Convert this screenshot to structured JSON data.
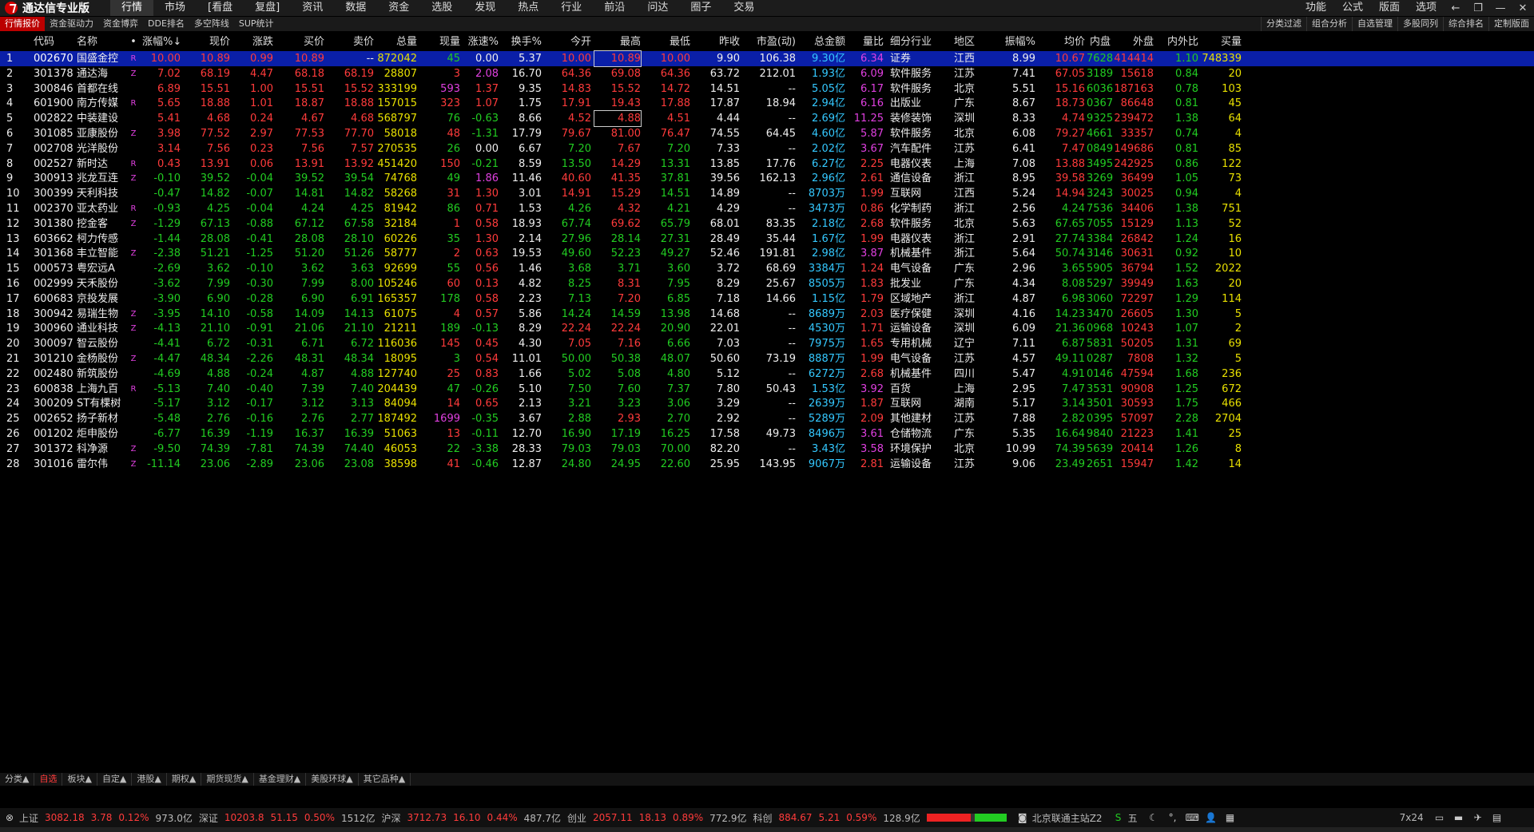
{
  "app": {
    "title": "通达信专业版"
  },
  "menu": [
    "行情",
    "市场",
    "[看盘",
    "复盘]",
    "资讯",
    "数据",
    "资金",
    "选股",
    "发现",
    "热点",
    "行业",
    "前沿",
    "问达",
    "圈子",
    "交易"
  ],
  "menu_right": [
    "功能",
    "公式",
    "版面",
    "选项"
  ],
  "subtoolbar": {
    "left": [
      "行情报价",
      "资金驱动力",
      "资金博弈",
      "DDE排名",
      "多空阵线",
      "SUP统计"
    ],
    "right": [
      "分类过滤",
      "组合分析",
      "自选管理",
      "多股同列",
      "综合排名",
      "定制版面"
    ]
  },
  "columns": [
    "",
    "代码",
    "名称",
    "•",
    "涨幅%↓",
    "现价",
    "涨跌",
    "买价",
    "卖价",
    "总量",
    "现量",
    "涨速%",
    "换手%",
    "今开",
    "最高",
    "最低",
    "昨收",
    "市盈(动)",
    "总金额",
    "量比",
    "细分行业",
    "地区",
    "振幅%",
    "均价",
    "内盘",
    "外盘",
    "内外比",
    "买量"
  ],
  "rows": [
    {
      "n": "1",
      "code": "002670",
      "name": "国盛金控",
      "t": "R",
      "chg": "10.00",
      "price": "10.89",
      "diff": "0.99",
      "bid": "10.89",
      "ask": "--",
      "vol": "872042",
      "cur": "45",
      "spd": "0.00",
      "turn": "5.37",
      "open": "10.00",
      "high": "10.89",
      "low": "10.00",
      "pre": "9.90",
      "pe": "106.38",
      "amt": "9.30亿",
      "lb": "6.34",
      "ind": "证券",
      "reg": "江西",
      "amp": "8.99",
      "avg": "10.67",
      "inn": "7628",
      "out": "414414",
      "ratio": "1.10",
      "bvol": "748339"
    },
    {
      "n": "2",
      "code": "301378",
      "name": "通达海",
      "t": "Z",
      "chg": "7.02",
      "price": "68.19",
      "diff": "4.47",
      "bid": "68.18",
      "ask": "68.19",
      "vol": "28807",
      "cur": "3",
      "spd": "2.08",
      "turn": "16.70",
      "open": "64.36",
      "high": "69.08",
      "low": "64.36",
      "pre": "63.72",
      "pe": "212.01",
      "amt": "1.93亿",
      "lb": "6.09",
      "ind": "软件服务",
      "reg": "江苏",
      "amp": "7.41",
      "avg": "67.05",
      "inn": "3189",
      "out": "15618",
      "ratio": "0.84",
      "bvol": "20"
    },
    {
      "n": "3",
      "code": "300846",
      "name": "首都在线",
      "t": "",
      "chg": "6.89",
      "price": "15.51",
      "diff": "1.00",
      "bid": "15.51",
      "ask": "15.52",
      "vol": "333199",
      "cur": "593",
      "spd": "1.37",
      "turn": "9.35",
      "open": "14.83",
      "high": "15.52",
      "low": "14.72",
      "pre": "14.51",
      "pe": "--",
      "amt": "5.05亿",
      "lb": "6.17",
      "ind": "软件服务",
      "reg": "北京",
      "amp": "5.51",
      "avg": "15.16",
      "inn": "6036",
      "out": "187163",
      "ratio": "0.78",
      "bvol": "103"
    },
    {
      "n": "4",
      "code": "601900",
      "name": "南方传媒",
      "t": "R",
      "chg": "5.65",
      "price": "18.88",
      "diff": "1.01",
      "bid": "18.87",
      "ask": "18.88",
      "vol": "157015",
      "cur": "323",
      "spd": "1.07",
      "turn": "1.75",
      "open": "17.91",
      "high": "19.43",
      "low": "17.88",
      "pre": "17.87",
      "pe": "18.94",
      "amt": "2.94亿",
      "lb": "6.16",
      "ind": "出版业",
      "reg": "广东",
      "amp": "8.67",
      "avg": "18.73",
      "inn": "0367",
      "out": "86648",
      "ratio": "0.81",
      "bvol": "45"
    },
    {
      "n": "5",
      "code": "002822",
      "name": "中装建设",
      "t": "",
      "chg": "5.41",
      "price": "4.68",
      "diff": "0.24",
      "bid": "4.67",
      "ask": "4.68",
      "vol": "568797",
      "cur": "76",
      "spd": "-0.63",
      "turn": "8.66",
      "open": "4.52",
      "high": "4.88",
      "low": "4.51",
      "pre": "4.44",
      "pe": "--",
      "amt": "2.69亿",
      "lb": "11.25",
      "ind": "装修装饰",
      "reg": "深圳",
      "amp": "8.33",
      "avg": "4.74",
      "inn": "9325",
      "out": "239472",
      "ratio": "1.38",
      "bvol": "64"
    },
    {
      "n": "6",
      "code": "301085",
      "name": "亚康股份",
      "t": "Z",
      "chg": "3.98",
      "price": "77.52",
      "diff": "2.97",
      "bid": "77.53",
      "ask": "77.70",
      "vol": "58018",
      "cur": "48",
      "spd": "-1.31",
      "turn": "17.79",
      "open": "79.67",
      "high": "81.00",
      "low": "76.47",
      "pre": "74.55",
      "pe": "64.45",
      "amt": "4.60亿",
      "lb": "5.87",
      "ind": "软件服务",
      "reg": "北京",
      "amp": "6.08",
      "avg": "79.27",
      "inn": "4661",
      "out": "33357",
      "ratio": "0.74",
      "bvol": "4"
    },
    {
      "n": "7",
      "code": "002708",
      "name": "光洋股份",
      "t": "",
      "chg": "3.14",
      "price": "7.56",
      "diff": "0.23",
      "bid": "7.56",
      "ask": "7.57",
      "vol": "270535",
      "cur": "26",
      "spd": "0.00",
      "turn": "6.67",
      "open": "7.20",
      "high": "7.67",
      "low": "7.20",
      "pre": "7.33",
      "pe": "--",
      "amt": "2.02亿",
      "lb": "3.67",
      "ind": "汽车配件",
      "reg": "江苏",
      "amp": "6.41",
      "avg": "7.47",
      "inn": "0849",
      "out": "149686",
      "ratio": "0.81",
      "bvol": "85"
    },
    {
      "n": "8",
      "code": "002527",
      "name": "新时达",
      "t": "R",
      "chg": "0.43",
      "price": "13.91",
      "diff": "0.06",
      "bid": "13.91",
      "ask": "13.92",
      "vol": "451420",
      "cur": "150",
      "spd": "-0.21",
      "turn": "8.59",
      "open": "13.50",
      "high": "14.29",
      "low": "13.31",
      "pre": "13.85",
      "pe": "17.76",
      "amt": "6.27亿",
      "lb": "2.25",
      "ind": "电器仪表",
      "reg": "上海",
      "amp": "7.08",
      "avg": "13.88",
      "inn": "3495",
      "out": "242925",
      "ratio": "0.86",
      "bvol": "122"
    },
    {
      "n": "9",
      "code": "300913",
      "name": "兆龙互连",
      "t": "Z",
      "chg": "-0.10",
      "price": "39.52",
      "diff": "-0.04",
      "bid": "39.52",
      "ask": "39.54",
      "vol": "74768",
      "cur": "49",
      "spd": "1.86",
      "turn": "11.46",
      "open": "40.60",
      "high": "41.35",
      "low": "37.81",
      "pre": "39.56",
      "pe": "162.13",
      "amt": "2.96亿",
      "lb": "2.61",
      "ind": "通信设备",
      "reg": "浙江",
      "amp": "8.95",
      "avg": "39.58",
      "inn": "3269",
      "out": "36499",
      "ratio": "1.05",
      "bvol": "73"
    },
    {
      "n": "10",
      "code": "300399",
      "name": "天利科技",
      "t": "",
      "chg": "-0.47",
      "price": "14.82",
      "diff": "-0.07",
      "bid": "14.81",
      "ask": "14.82",
      "vol": "58268",
      "cur": "31",
      "spd": "1.30",
      "turn": "3.01",
      "open": "14.91",
      "high": "15.29",
      "low": "14.51",
      "pre": "14.89",
      "pe": "--",
      "amt": "8703万",
      "lb": "1.99",
      "ind": "互联网",
      "reg": "江西",
      "amp": "5.24",
      "avg": "14.94",
      "inn": "3243",
      "out": "30025",
      "ratio": "0.94",
      "bvol": "4"
    },
    {
      "n": "11",
      "code": "002370",
      "name": "亚太药业",
      "t": "R",
      "chg": "-0.93",
      "price": "4.25",
      "diff": "-0.04",
      "bid": "4.24",
      "ask": "4.25",
      "vol": "81942",
      "cur": "86",
      "spd": "0.71",
      "turn": "1.53",
      "open": "4.26",
      "high": "4.32",
      "low": "4.21",
      "pre": "4.29",
      "pe": "--",
      "amt": "3473万",
      "lb": "0.86",
      "ind": "化学制药",
      "reg": "浙江",
      "amp": "2.56",
      "avg": "4.24",
      "inn": "7536",
      "out": "34406",
      "ratio": "1.38",
      "bvol": "751"
    },
    {
      "n": "12",
      "code": "301380",
      "name": "挖金客",
      "t": "Z",
      "chg": "-1.29",
      "price": "67.13",
      "diff": "-0.88",
      "bid": "67.12",
      "ask": "67.58",
      "vol": "32184",
      "cur": "1",
      "spd": "0.58",
      "turn": "18.93",
      "open": "67.74",
      "high": "69.62",
      "low": "65.79",
      "pre": "68.01",
      "pe": "83.35",
      "amt": "2.18亿",
      "lb": "2.68",
      "ind": "软件服务",
      "reg": "北京",
      "amp": "5.63",
      "avg": "67.65",
      "inn": "7055",
      "out": "15129",
      "ratio": "1.13",
      "bvol": "52"
    },
    {
      "n": "13",
      "code": "603662",
      "name": "柯力传感",
      "t": "",
      "chg": "-1.44",
      "price": "28.08",
      "diff": "-0.41",
      "bid": "28.08",
      "ask": "28.10",
      "vol": "60226",
      "cur": "35",
      "spd": "1.30",
      "turn": "2.14",
      "open": "27.96",
      "high": "28.14",
      "low": "27.31",
      "pre": "28.49",
      "pe": "35.44",
      "amt": "1.67亿",
      "lb": "1.99",
      "ind": "电器仪表",
      "reg": "浙江",
      "amp": "2.91",
      "avg": "27.74",
      "inn": "3384",
      "out": "26842",
      "ratio": "1.24",
      "bvol": "16"
    },
    {
      "n": "14",
      "code": "301368",
      "name": "丰立智能",
      "t": "Z",
      "chg": "-2.38",
      "price": "51.21",
      "diff": "-1.25",
      "bid": "51.20",
      "ask": "51.26",
      "vol": "58777",
      "cur": "2",
      "spd": "0.63",
      "turn": "19.53",
      "open": "49.60",
      "high": "52.23",
      "low": "49.27",
      "pre": "52.46",
      "pe": "191.81",
      "amt": "2.98亿",
      "lb": "3.87",
      "ind": "机械基件",
      "reg": "浙江",
      "amp": "5.64",
      "avg": "50.74",
      "inn": "3146",
      "out": "30631",
      "ratio": "0.92",
      "bvol": "10"
    },
    {
      "n": "15",
      "code": "000573",
      "name": "粤宏远A",
      "t": "",
      "chg": "-2.69",
      "price": "3.62",
      "diff": "-0.10",
      "bid": "3.62",
      "ask": "3.63",
      "vol": "92699",
      "cur": "55",
      "spd": "0.56",
      "turn": "1.46",
      "open": "3.68",
      "high": "3.71",
      "low": "3.60",
      "pre": "3.72",
      "pe": "68.69",
      "amt": "3384万",
      "lb": "1.24",
      "ind": "电气设备",
      "reg": "广东",
      "amp": "2.96",
      "avg": "3.65",
      "inn": "5905",
      "out": "36794",
      "ratio": "1.52",
      "bvol": "2022"
    },
    {
      "n": "16",
      "code": "002999",
      "name": "天禾股份",
      "t": "",
      "chg": "-3.62",
      "price": "7.99",
      "diff": "-0.30",
      "bid": "7.99",
      "ask": "8.00",
      "vol": "105246",
      "cur": "60",
      "spd": "0.13",
      "turn": "4.82",
      "open": "8.25",
      "high": "8.31",
      "low": "7.95",
      "pre": "8.29",
      "pe": "25.67",
      "amt": "8505万",
      "lb": "1.83",
      "ind": "批发业",
      "reg": "广东",
      "amp": "4.34",
      "avg": "8.08",
      "inn": "5297",
      "out": "39949",
      "ratio": "1.63",
      "bvol": "20"
    },
    {
      "n": "17",
      "code": "600683",
      "name": "京投发展",
      "t": "",
      "chg": "-3.90",
      "price": "6.90",
      "diff": "-0.28",
      "bid": "6.90",
      "ask": "6.91",
      "vol": "165357",
      "cur": "178",
      "spd": "0.58",
      "turn": "2.23",
      "open": "7.13",
      "high": "7.20",
      "low": "6.85",
      "pre": "7.18",
      "pe": "14.66",
      "amt": "1.15亿",
      "lb": "1.79",
      "ind": "区域地产",
      "reg": "浙江",
      "amp": "4.87",
      "avg": "6.98",
      "inn": "3060",
      "out": "72297",
      "ratio": "1.29",
      "bvol": "114"
    },
    {
      "n": "18",
      "code": "300942",
      "name": "易瑞生物",
      "t": "Z",
      "chg": "-3.95",
      "price": "14.10",
      "diff": "-0.58",
      "bid": "14.09",
      "ask": "14.13",
      "vol": "61075",
      "cur": "4",
      "spd": "0.57",
      "turn": "5.86",
      "open": "14.24",
      "high": "14.59",
      "low": "13.98",
      "pre": "14.68",
      "pe": "--",
      "amt": "8689万",
      "lb": "2.03",
      "ind": "医疗保健",
      "reg": "深圳",
      "amp": "4.16",
      "avg": "14.23",
      "inn": "3470",
      "out": "26605",
      "ratio": "1.30",
      "bvol": "5"
    },
    {
      "n": "19",
      "code": "300960",
      "name": "通业科技",
      "t": "Z",
      "chg": "-4.13",
      "price": "21.10",
      "diff": "-0.91",
      "bid": "21.06",
      "ask": "21.10",
      "vol": "21211",
      "cur": "189",
      "spd": "-0.13",
      "turn": "8.29",
      "open": "22.24",
      "high": "22.24",
      "low": "20.90",
      "pre": "22.01",
      "pe": "--",
      "amt": "4530万",
      "lb": "1.71",
      "ind": "运输设备",
      "reg": "深圳",
      "amp": "6.09",
      "avg": "21.36",
      "inn": "0968",
      "out": "10243",
      "ratio": "1.07",
      "bvol": "2"
    },
    {
      "n": "20",
      "code": "300097",
      "name": "智云股份",
      "t": "",
      "chg": "-4.41",
      "price": "6.72",
      "diff": "-0.31",
      "bid": "6.71",
      "ask": "6.72",
      "vol": "116036",
      "cur": "145",
      "spd": "0.45",
      "turn": "4.30",
      "open": "7.05",
      "high": "7.16",
      "low": "6.66",
      "pre": "7.03",
      "pe": "--",
      "amt": "7975万",
      "lb": "1.65",
      "ind": "专用机械",
      "reg": "辽宁",
      "amp": "7.11",
      "avg": "6.87",
      "inn": "5831",
      "out": "50205",
      "ratio": "1.31",
      "bvol": "69"
    },
    {
      "n": "21",
      "code": "301210",
      "name": "金杨股份",
      "t": "Z",
      "chg": "-4.47",
      "price": "48.34",
      "diff": "-2.26",
      "bid": "48.31",
      "ask": "48.34",
      "vol": "18095",
      "cur": "3",
      "spd": "0.54",
      "turn": "11.01",
      "open": "50.00",
      "high": "50.38",
      "low": "48.07",
      "pre": "50.60",
      "pe": "73.19",
      "amt": "8887万",
      "lb": "1.99",
      "ind": "电气设备",
      "reg": "江苏",
      "amp": "4.57",
      "avg": "49.11",
      "inn": "0287",
      "out": "7808",
      "ratio": "1.32",
      "bvol": "5"
    },
    {
      "n": "22",
      "code": "002480",
      "name": "新筑股份",
      "t": "",
      "chg": "-4.69",
      "price": "4.88",
      "diff": "-0.24",
      "bid": "4.87",
      "ask": "4.88",
      "vol": "127740",
      "cur": "25",
      "spd": "0.83",
      "turn": "1.66",
      "open": "5.02",
      "high": "5.08",
      "low": "4.80",
      "pre": "5.12",
      "pe": "--",
      "amt": "6272万",
      "lb": "2.68",
      "ind": "机械基件",
      "reg": "四川",
      "amp": "5.47",
      "avg": "4.91",
      "inn": "0146",
      "out": "47594",
      "ratio": "1.68",
      "bvol": "236"
    },
    {
      "n": "23",
      "code": "600838",
      "name": "上海九百",
      "t": "R",
      "chg": "-5.13",
      "price": "7.40",
      "diff": "-0.40",
      "bid": "7.39",
      "ask": "7.40",
      "vol": "204439",
      "cur": "47",
      "spd": "-0.26",
      "turn": "5.10",
      "open": "7.50",
      "high": "7.60",
      "low": "7.37",
      "pre": "7.80",
      "pe": "50.43",
      "amt": "1.53亿",
      "lb": "3.92",
      "ind": "百货",
      "reg": "上海",
      "amp": "2.95",
      "avg": "7.47",
      "inn": "3531",
      "out": "90908",
      "ratio": "1.25",
      "bvol": "672"
    },
    {
      "n": "24",
      "code": "300209",
      "name": "ST有棵树",
      "t": "",
      "chg": "-5.17",
      "price": "3.12",
      "diff": "-0.17",
      "bid": "3.12",
      "ask": "3.13",
      "vol": "84094",
      "cur": "14",
      "spd": "0.65",
      "turn": "2.13",
      "open": "3.21",
      "high": "3.23",
      "low": "3.06",
      "pre": "3.29",
      "pe": "--",
      "amt": "2639万",
      "lb": "1.87",
      "ind": "互联网",
      "reg": "湖南",
      "amp": "5.17",
      "avg": "3.14",
      "inn": "3501",
      "out": "30593",
      "ratio": "1.75",
      "bvol": "466"
    },
    {
      "n": "25",
      "code": "002652",
      "name": "扬子新材",
      "t": "",
      "chg": "-5.48",
      "price": "2.76",
      "diff": "-0.16",
      "bid": "2.76",
      "ask": "2.77",
      "vol": "187492",
      "cur": "1699",
      "spd": "-0.35",
      "turn": "3.67",
      "open": "2.88",
      "high": "2.93",
      "low": "2.70",
      "pre": "2.92",
      "pe": "--",
      "amt": "5289万",
      "lb": "2.09",
      "ind": "其他建材",
      "reg": "江苏",
      "amp": "7.88",
      "avg": "2.82",
      "inn": "0395",
      "out": "57097",
      "ratio": "2.28",
      "bvol": "2704"
    },
    {
      "n": "26",
      "code": "001202",
      "name": "炬申股份",
      "t": "",
      "chg": "-6.77",
      "price": "16.39",
      "diff": "-1.19",
      "bid": "16.37",
      "ask": "16.39",
      "vol": "51063",
      "cur": "13",
      "spd": "-0.11",
      "turn": "12.70",
      "open": "16.90",
      "high": "17.19",
      "low": "16.25",
      "pre": "17.58",
      "pe": "49.73",
      "amt": "8496万",
      "lb": "3.61",
      "ind": "仓储物流",
      "reg": "广东",
      "amp": "5.35",
      "avg": "16.64",
      "inn": "9840",
      "out": "21223",
      "ratio": "1.41",
      "bvol": "25"
    },
    {
      "n": "27",
      "code": "301372",
      "name": "科净源",
      "t": "Z",
      "chg": "-9.50",
      "price": "74.39",
      "diff": "-7.81",
      "bid": "74.39",
      "ask": "74.40",
      "vol": "46053",
      "cur": "22",
      "spd": "-3.38",
      "turn": "28.33",
      "open": "79.03",
      "high": "79.03",
      "low": "70.00",
      "pre": "82.20",
      "pe": "--",
      "amt": "3.43亿",
      "lb": "3.58",
      "ind": "环境保护",
      "reg": "北京",
      "amp": "10.99",
      "avg": "74.39",
      "inn": "5639",
      "out": "20414",
      "ratio": "1.26",
      "bvol": "8"
    },
    {
      "n": "28",
      "code": "301016",
      "name": "雷尔伟",
      "t": "Z",
      "chg": "-11.14",
      "price": "23.06",
      "diff": "-2.89",
      "bid": "23.06",
      "ask": "23.08",
      "vol": "38598",
      "cur": "41",
      "spd": "-0.46",
      "turn": "12.87",
      "open": "24.80",
      "high": "24.95",
      "low": "22.60",
      "pre": "25.95",
      "pe": "143.95",
      "amt": "9067万",
      "lb": "2.81",
      "ind": "运输设备",
      "reg": "江苏",
      "amp": "9.06",
      "avg": "23.49",
      "inn": "2651",
      "out": "15947",
      "ratio": "1.42",
      "bvol": "14"
    }
  ],
  "bottom_tabs": [
    "分类▲",
    "自选",
    "板块▲",
    "自定▲",
    "港股▲",
    "期权▲",
    "期货现货▲",
    "基金理财▲",
    "美股环球▲",
    "其它品种▲"
  ],
  "status": {
    "sh_label": "上证",
    "sh_idx": "3082.18",
    "sh_chg": "3.78",
    "sh_pct": "0.12%",
    "sh_amt": "973.0亿",
    "sz_label": "深证",
    "sz_idx": "10203.8",
    "sz_chg": "51.15",
    "sz_pct": "0.50%",
    "sz_amt": "1512亿",
    "hs_label": "沪深",
    "hs_idx": "3712.73",
    "hs_chg": "16.10",
    "hs_pct": "0.44%",
    "hs_amt": "487.7亿",
    "cy_label": "创业",
    "cy_idx": "2057.11",
    "cy_chg": "18.13",
    "cy_pct": "0.89%",
    "cy_amt": "772.9亿",
    "kc_label": "科创",
    "kc_idx": "884.67",
    "kc_chg": "5.21",
    "kc_pct": "0.59%",
    "kc_amt": "128.9亿",
    "server": "北京联通主站Z2",
    "ime": "五",
    "time_mode": "7x24"
  }
}
